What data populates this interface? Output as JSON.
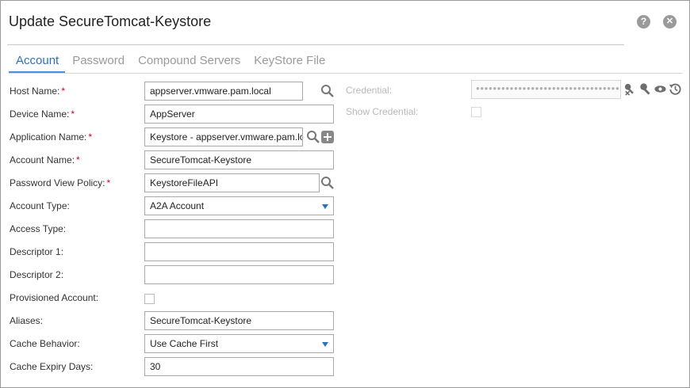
{
  "dialog": {
    "title": "Update SecureTomcat-Keystore",
    "help_glyph": "?",
    "close_glyph": "✕"
  },
  "tabs": [
    {
      "label": "Account",
      "active": true
    },
    {
      "label": "Password",
      "active": false
    },
    {
      "label": "Compound Servers",
      "active": false
    },
    {
      "label": "KeyStore File",
      "active": false
    }
  ],
  "form": {
    "host_name": {
      "label": "Host Name:",
      "required": "*",
      "value": "appserver.vmware.pam.local"
    },
    "device_name": {
      "label": "Device Name:",
      "required": "*",
      "value": "AppServer"
    },
    "application_name": {
      "label": "Application Name:",
      "required": "*",
      "value": "Keystore - appserver.vmware.pam.local"
    },
    "account_name": {
      "label": "Account Name:",
      "required": "*",
      "value": "SecureTomcat-Keystore"
    },
    "password_view_policy": {
      "label": "Password View Policy:",
      "required": "*",
      "value": "KeystoreFileAPI"
    },
    "account_type": {
      "label": "Account Type:",
      "value": "A2A Account"
    },
    "access_type": {
      "label": "Access Type:",
      "value": ""
    },
    "descriptor_1": {
      "label": "Descriptor 1:",
      "value": ""
    },
    "descriptor_2": {
      "label": "Descriptor 2:",
      "value": ""
    },
    "provisioned_account": {
      "label": "Provisioned Account:",
      "checked": false
    },
    "aliases": {
      "label": "Aliases:",
      "value": "SecureTomcat-Keystore"
    },
    "cache_behavior": {
      "label": "Cache Behavior:",
      "value": "Use Cache First"
    },
    "cache_expiry_days": {
      "label": "Cache Expiry Days:",
      "value": "30"
    }
  },
  "credential": {
    "label": "Credential:",
    "masked_value": "●●●●●●●●●●●●●●●●●●●●●●●●●●●●●●●●●●●●",
    "show_label": "Show Credential:",
    "show_checked": false
  },
  "colors": {
    "accent": "#2b73b7",
    "required": "#d0021b",
    "disabled_text": "#b8b8b8",
    "icon_gray": "#888888"
  }
}
